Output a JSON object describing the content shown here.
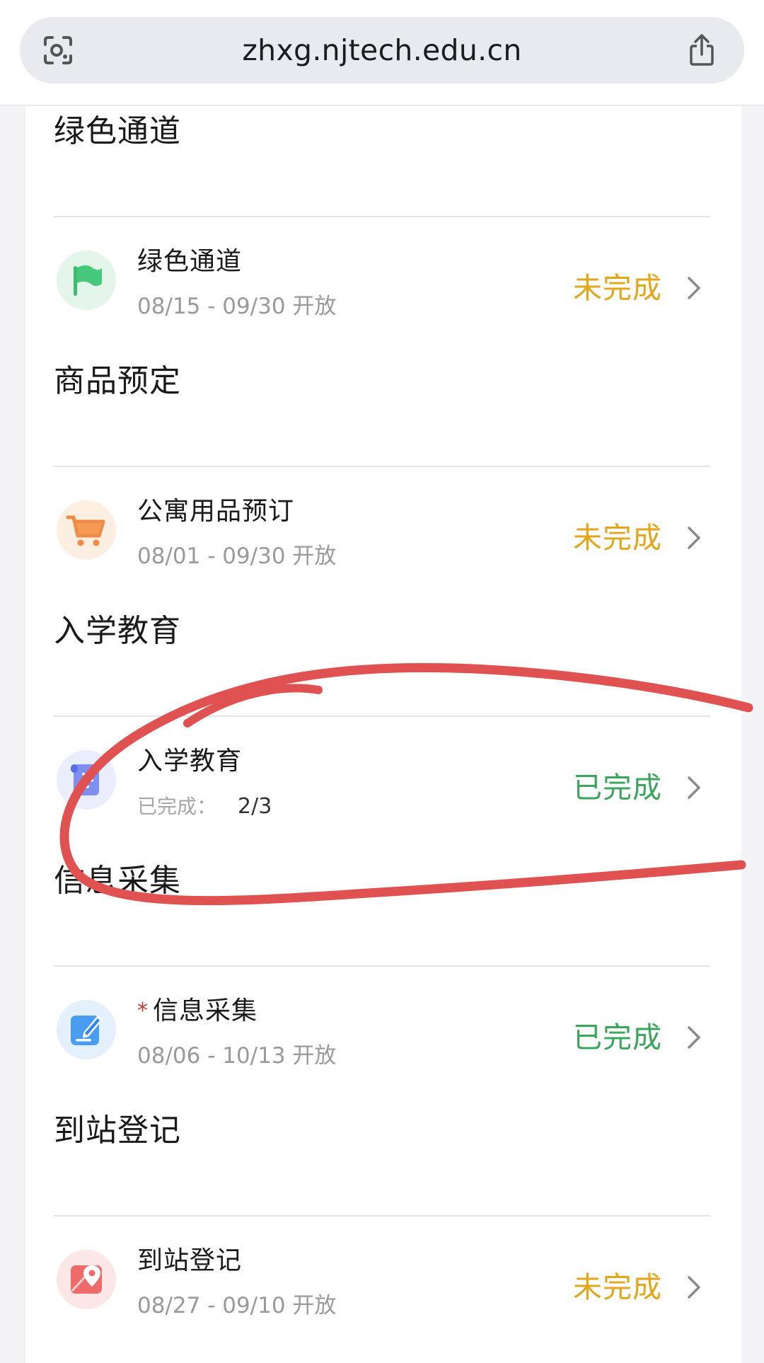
{
  "browser": {
    "url": "zhxg.njtech.edu.cn",
    "left_icon": "camera-scan-icon",
    "right_icon": "share-icon"
  },
  "colors": {
    "pending": "#e3a61a",
    "done": "#3aa65b",
    "required_mark": "#c0392b",
    "annotation": "#e05050"
  },
  "sections": [
    {
      "title": "绿色通道",
      "item": {
        "icon": "flag-icon",
        "title": "绿色通道",
        "subtitle": "08/15 - 09/30 开放",
        "status": "未完成"
      }
    },
    {
      "title": "商品预定",
      "item": {
        "icon": "shopping-cart-icon",
        "title": "公寓用品预订",
        "subtitle": "08/01 - 09/30 开放",
        "status": "未完成"
      }
    },
    {
      "title": "入学教育",
      "item": {
        "icon": "scroll-icon",
        "title": "入学教育",
        "subtitle_label": "已完成：",
        "subtitle_value": "2/3",
        "status": "已完成"
      }
    },
    {
      "title": "信息采集",
      "item": {
        "icon": "edit-form-icon",
        "required": "*",
        "title": "信息采集",
        "subtitle": "08/06 - 10/13 开放",
        "status": "已完成"
      }
    },
    {
      "title": "到站登记",
      "item": {
        "icon": "map-pin-icon",
        "title": "到站登记",
        "subtitle": "08/27 - 09/10 开放",
        "status": "未完成"
      }
    }
  ]
}
